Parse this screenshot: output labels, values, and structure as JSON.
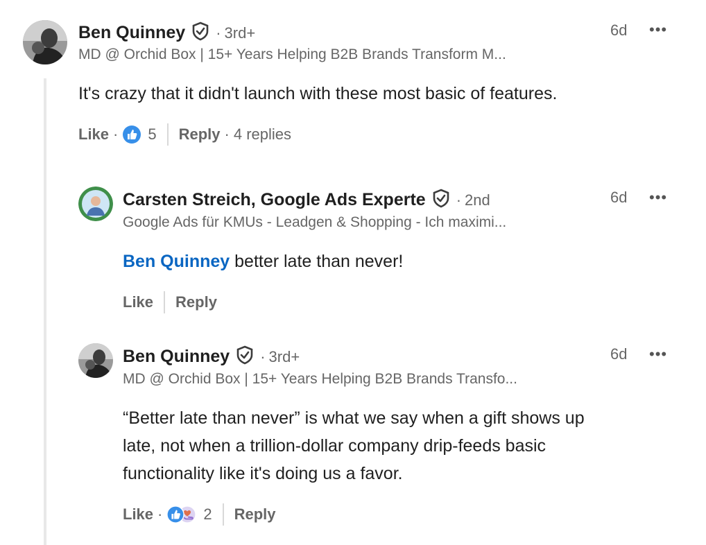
{
  "comment": {
    "author": "Ben Quinney",
    "degree": "3rd+",
    "headline": "MD @ Orchid Box | 15+ Years Helping B2B Brands Transform M...",
    "time": "6d",
    "text": "It's crazy that it didn't launch with these most basic of features.",
    "like_label": "Like",
    "reaction_count": "5",
    "reply_label": "Reply",
    "replies_label": "4 replies"
  },
  "reply1": {
    "author": "Carsten Streich, Google Ads Experte",
    "degree": "2nd",
    "headline": "Google Ads für KMUs - Leadgen & Shopping - Ich maximi...",
    "time": "6d",
    "mention": "Ben Quinney",
    "text": " better late than never!",
    "like_label": "Like",
    "reply_label": "Reply"
  },
  "reply2": {
    "author": "Ben Quinney",
    "degree": "3rd+",
    "headline": "MD @ Orchid Box | 15+ Years Helping B2B Brands Transfo...",
    "time": "6d",
    "text_lines": [
      "“Better late than never” is what we say when a gift shows up",
      "late, not when a trillion-dollar company drip-feeds basic",
      "functionality like it's doing us a favor."
    ],
    "like_label": "Like",
    "reaction_count": "2",
    "reply_label": "Reply"
  },
  "ui": {
    "separator_dot": "·",
    "more_glyph": "•••"
  },
  "colors": {
    "link": "#0a66c2",
    "muted": "#666666",
    "like_blue": "#378fe9"
  }
}
